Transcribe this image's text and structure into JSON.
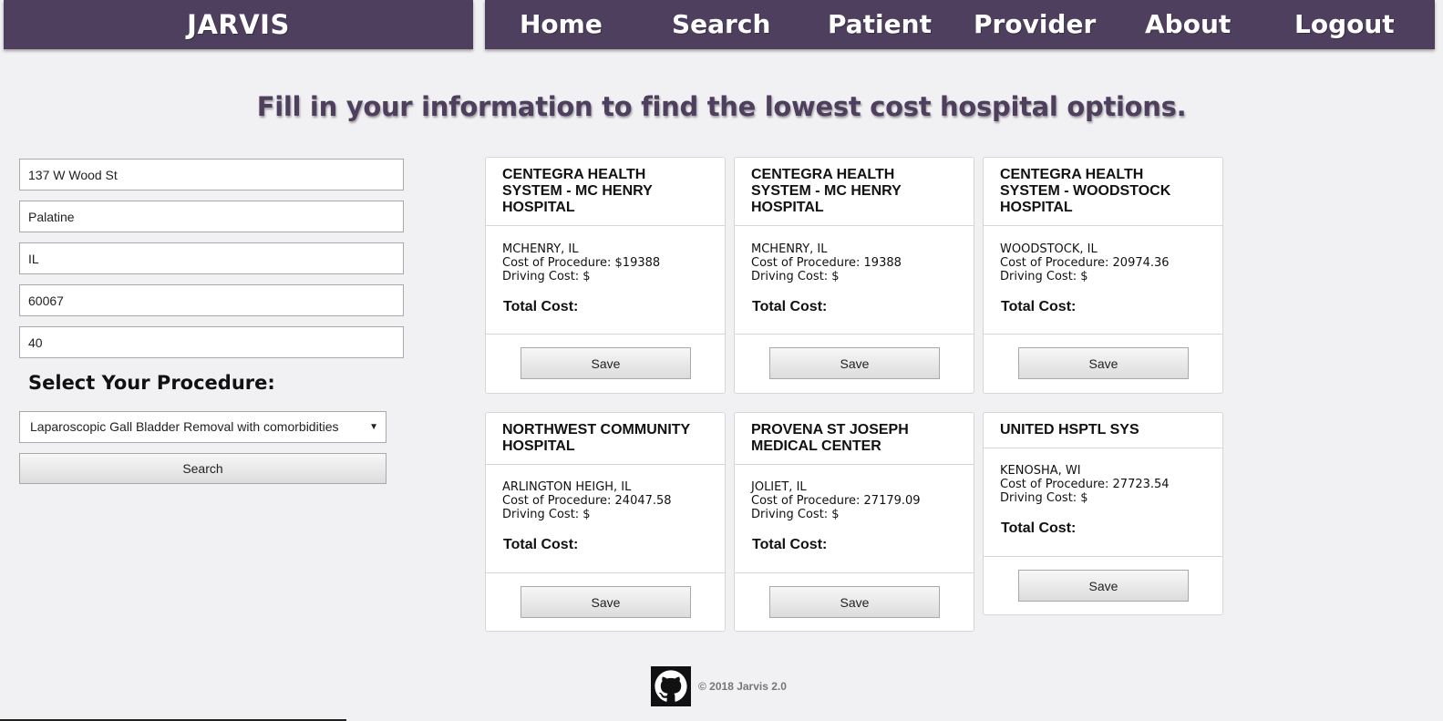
{
  "header": {
    "brand": "JARVIS",
    "nav": [
      {
        "label": "Home"
      },
      {
        "label": "Search"
      },
      {
        "label": "Patient"
      },
      {
        "label": "Provider"
      },
      {
        "label": "About"
      },
      {
        "label": "Logout"
      }
    ]
  },
  "page_title": "Fill in your information to find the lowest cost hospital options.",
  "form": {
    "address": "137 W Wood St",
    "city": "Palatine",
    "state": "IL",
    "zip": "60067",
    "radius": "40",
    "procedure_label": "Select Your Procedure:",
    "procedure_selected": "Laparoscopic Gall Bladder Removal with comorbidities",
    "search_label": "Search"
  },
  "cards": [
    {
      "name": "CENTEGRA HEALTH SYSTEM - MC HENRY HOSPITAL",
      "location": "MCHENRY, IL",
      "cost": "Cost of Procedure: $19388",
      "driving": "Driving Cost: $",
      "total": "Total Cost:",
      "save": "Save"
    },
    {
      "name": "CENTEGRA HEALTH SYSTEM - MC HENRY HOSPITAL",
      "location": "MCHENRY, IL",
      "cost": "Cost of Procedure: 19388",
      "driving": "Driving Cost: $",
      "total": "Total Cost:",
      "save": "Save"
    },
    {
      "name": "CENTEGRA HEALTH SYSTEM - WOODSTOCK HOSPITAL",
      "location": "WOODSTOCK, IL",
      "cost": "Cost of Procedure: 20974.36",
      "driving": "Driving Cost: $",
      "total": "Total Cost:",
      "save": "Save"
    },
    {
      "name": "NORTHWEST COMMUNITY HOSPITAL",
      "location": "ARLINGTON HEIGH, IL",
      "cost": "Cost of Procedure: 24047.58",
      "driving": "Driving Cost: $",
      "total": "Total Cost:",
      "save": "Save"
    },
    {
      "name": "PROVENA ST JOSEPH MEDICAL CENTER",
      "location": "JOLIET, IL",
      "cost": "Cost of Procedure: 27179.09",
      "driving": "Driving Cost: $",
      "total": "Total Cost:",
      "save": "Save"
    },
    {
      "name": "UNITED HSPTL SYS",
      "location": "KENOSHA, WI",
      "cost": "Cost of Procedure: 27723.54",
      "driving": "Driving Cost: $",
      "total": "Total Cost:",
      "save": "Save"
    }
  ],
  "footer": {
    "github_icon": "github-icon",
    "copyright": "© 2018 Jarvis 2.0"
  },
  "colors": {
    "header_bg": "#4f3f5e",
    "page_bg": "#f1f0f3"
  }
}
